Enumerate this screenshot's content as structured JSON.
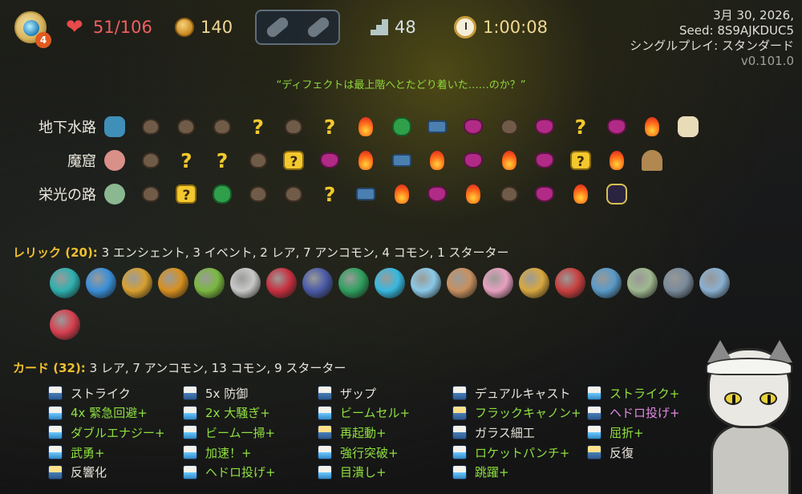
{
  "hud": {
    "ascension": "4",
    "hp": "51/106",
    "gold": "140",
    "floor": "48",
    "time": "1:00:08"
  },
  "meta": {
    "date": "3月 30, 2026,",
    "seed": "Seed: 8S9AJKDUC5",
    "mode": "シングルプレイ: スタンダード",
    "version": "v0.101.0"
  },
  "quote": "“ディフェクトは最上階へとたどり着いた……のか？”",
  "acts": [
    {
      "name": "地下水路",
      "nodes": [
        "boss-blue",
        "monster",
        "monster",
        "monster",
        "unknown",
        "monster",
        "unknown",
        "rest",
        "shop",
        "chest",
        "elite",
        "monster",
        "elite",
        "unknown",
        "elite",
        "rest",
        "scroll"
      ]
    },
    {
      "name": "魔窟",
      "nodes": [
        "boss-pink",
        "monster",
        "unknown",
        "unknown",
        "monster",
        "unknown-box",
        "elite",
        "rest",
        "chest",
        "rest",
        "elite",
        "rest",
        "elite",
        "unknown-box",
        "rest",
        "boss-bell"
      ]
    },
    {
      "name": "栄光の路",
      "nodes": [
        "boss-green",
        "monster",
        "unknown-box",
        "shop",
        "monster",
        "monster",
        "unknown",
        "chest",
        "rest",
        "elite",
        "rest",
        "monster",
        "elite",
        "rest",
        "boss-dark"
      ]
    }
  ],
  "relics_section": {
    "label": "レリック (20):",
    "summary": " 3 エンシェント, 3 イベント, 2 レア, 7 アンコモン, 4 コモン, 1 スターター",
    "colors": [
      "#2fb0b0",
      "#3a8fd8",
      "#d8a030",
      "#d89020",
      "#7ab840",
      "#c8c8c8",
      "#c83040",
      "#4a5aa8",
      "#2fa060",
      "#38b8e0",
      "#8ac8e8",
      "#c89060",
      "#e8a0c0",
      "#d8a840",
      "#c84040",
      "#5a9ac8",
      "#a0b890",
      "#7a8a9a",
      "#8ab0d0",
      "#d84050"
    ]
  },
  "cards_section": {
    "label": "カード (32):",
    "summary": " 3 レア, 7 アンコモン, 13 コモン, 9 スターター",
    "columns": [
      [
        {
          "name": "ストライク",
          "style": "",
          "icon": ""
        },
        {
          "name": "4x 緊急回避+",
          "style": "green",
          "icon": "up"
        },
        {
          "name": "ダブルエナジー+",
          "style": "green",
          "icon": "up"
        },
        {
          "name": "武勇+",
          "style": "green",
          "icon": "up"
        },
        {
          "name": "反響化",
          "style": "",
          "icon": "gold"
        }
      ],
      [
        {
          "name": "5x 防御",
          "style": "",
          "icon": ""
        },
        {
          "name": "2x 大騒ぎ+",
          "style": "green",
          "icon": "up"
        },
        {
          "name": "ビーム一掃+",
          "style": "green",
          "icon": "up"
        },
        {
          "name": "加速！+",
          "style": "green",
          "icon": "up"
        },
        {
          "name": "ヘドロ投げ+",
          "style": "green",
          "icon": "up"
        }
      ],
      [
        {
          "name": "ザップ",
          "style": "",
          "icon": ""
        },
        {
          "name": "ビームセル+",
          "style": "green",
          "icon": "up"
        },
        {
          "name": "再起動+",
          "style": "green",
          "icon": "gold"
        },
        {
          "name": "強行突破+",
          "style": "green",
          "icon": "up"
        },
        {
          "name": "目潰し+",
          "style": "green",
          "icon": "up"
        }
      ],
      [
        {
          "name": "デュアルキャスト",
          "style": "",
          "icon": ""
        },
        {
          "name": "フラックキャノン+",
          "style": "green",
          "icon": "gold"
        },
        {
          "name": "ガラス細工",
          "style": "",
          "icon": ""
        },
        {
          "name": "ロケットパンチ+",
          "style": "green",
          "icon": "up"
        },
        {
          "name": "跳躍+",
          "style": "green",
          "icon": "up"
        }
      ],
      [
        {
          "name": "ストライク+",
          "style": "green",
          "icon": "up"
        },
        {
          "name": "ヘドロ投げ+",
          "style": "pink",
          "icon": ""
        },
        {
          "name": "屈折+",
          "style": "green",
          "icon": "up"
        },
        {
          "name": "反復",
          "style": "",
          "icon": "gold"
        }
      ]
    ]
  }
}
